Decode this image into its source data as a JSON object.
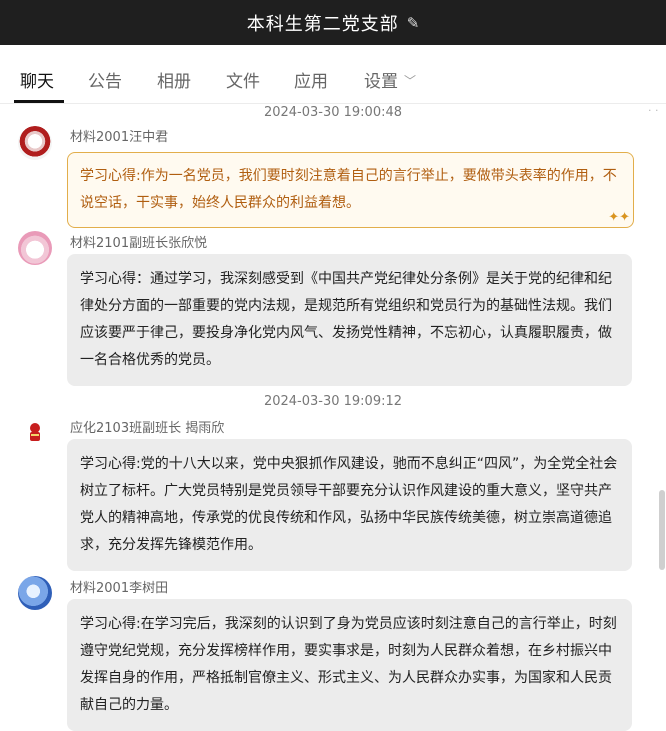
{
  "window": {
    "title": "本科生第二党支部",
    "edit_icon": "pencil-icon"
  },
  "tabs": [
    {
      "label": "聊天",
      "active": true
    },
    {
      "label": "公告"
    },
    {
      "label": "相册"
    },
    {
      "label": "文件"
    },
    {
      "label": "应用"
    },
    {
      "label": "设置",
      "has_dropdown": true
    }
  ],
  "messages": {
    "ts1": "2024-03-30 19:00:48",
    "ts2": "2024-03-30 19:09:12",
    "m1": {
      "sender": "材料2001汪中君",
      "text": "学习心得:作为一名党员，我们要时刻注意着自己的言行举止，要做带头表率的作用，不说空话，干实事，始终人民群众的利益着想。",
      "style": "gold"
    },
    "m2": {
      "sender": "材料2101副班长张欣悦",
      "text": "学习心得：通过学习，我深刻感受到《中国共产党纪律处分条例》是关于党的纪律和纪律处分方面的一部重要的党内法规，是规范所有党组织和党员行为的基础性法规。我们应该要严于律己，要投身净化党内风气、发扬党性精神，不忘初心，认真履职履责，做一名合格优秀的党员。"
    },
    "m3": {
      "sender": "应化2103班副班长 揭雨欣",
      "text": "学习心得:党的十八大以来，党中央狠抓作风建设，驰而不息纠正“四风”，为全党全社会树立了标杆。广大党员特别是党员领导干部要充分认识作风建设的重大意义，坚守共产党人的精神高地，传承党的优良传统和作风，弘扬中华民族传统美德，树立崇高道德追求，充分发挥先锋模范作用。"
    },
    "m4": {
      "sender": "材料2001李树田",
      "text": "学习心得:在学习完后，我深刻的认识到了身为党员应该时刻注意自己的言行举止，时刻遵守党纪党规，充分发挥榜样作用，要实事求是，时刻为人民群众着想，在乡村振兴中发挥自身的作用，严格抵制官僚主义、形式主义、为人民群众办实事，为国家和人民贡献自己的力量。"
    }
  },
  "colors": {
    "gold_border": "#e2ae4b",
    "gold_text": "#b05e10",
    "bubble_bg": "#ececec",
    "titlebar": "#1f1f1f"
  }
}
